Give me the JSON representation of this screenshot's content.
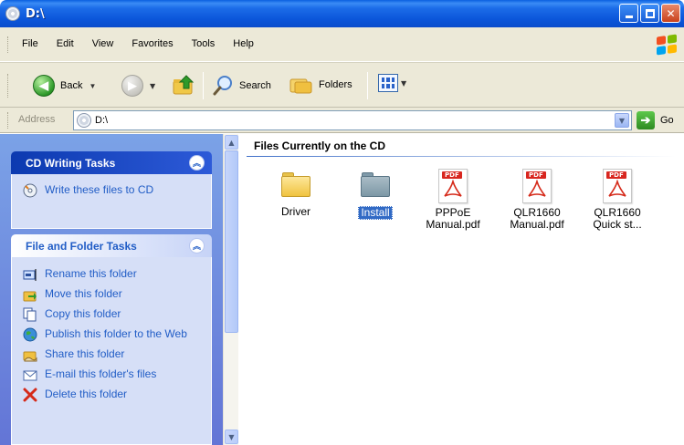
{
  "window": {
    "title": "D:\\"
  },
  "menu": {
    "items": [
      "File",
      "Edit",
      "View",
      "Favorites",
      "Tools",
      "Help"
    ]
  },
  "toolbar": {
    "back_label": "Back",
    "search_label": "Search",
    "folders_label": "Folders"
  },
  "address": {
    "label": "Address",
    "value": "D:\\",
    "go_label": "Go"
  },
  "cd_tasks": {
    "title": "CD Writing Tasks",
    "items": [
      {
        "label": "Write these files to CD",
        "icon": "burn-cd-icon"
      }
    ]
  },
  "file_tasks": {
    "title": "File and Folder Tasks",
    "items": [
      {
        "label": "Rename this folder",
        "icon": "rename-icon"
      },
      {
        "label": "Move this folder",
        "icon": "move-icon"
      },
      {
        "label": "Copy this folder",
        "icon": "copy-icon"
      },
      {
        "label": "Publish this folder to the Web",
        "icon": "publish-web-icon"
      },
      {
        "label": "Share this folder",
        "icon": "share-icon"
      },
      {
        "label": "E-mail this folder's files",
        "icon": "email-icon"
      },
      {
        "label": "Delete this folder",
        "icon": "delete-icon"
      }
    ]
  },
  "content": {
    "group_title": "Files Currently on the CD",
    "files": [
      {
        "name": "Driver",
        "type": "folder",
        "selected": false
      },
      {
        "name": "Install",
        "type": "folder",
        "selected": true
      },
      {
        "name": "PPPoE Manual.pdf",
        "type": "pdf",
        "selected": false
      },
      {
        "name": "QLR1660 Manual.pdf",
        "type": "pdf",
        "selected": false
      },
      {
        "name": "QLR1660 Quick st...",
        "type": "pdf",
        "selected": false
      }
    ]
  },
  "colors": {
    "title_bar": "#0b56da",
    "task_link": "#215dc6",
    "selection": "#316ac5"
  }
}
